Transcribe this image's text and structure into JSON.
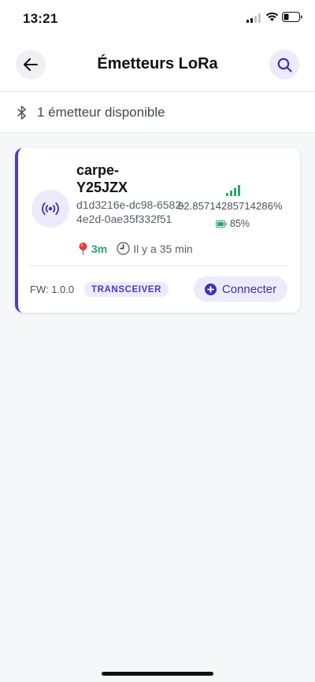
{
  "status_bar": {
    "time": "13:21",
    "signal_icon": "cellular-signal-icon",
    "wifi_icon": "wifi-icon",
    "battery_icon": "battery-icon"
  },
  "header": {
    "title": "Émetteurs LoRa",
    "back_icon": "arrow-left-icon",
    "search_icon": "search-icon"
  },
  "subheader": {
    "icon": "bluetooth-icon",
    "count_text": "1 émetteur disponible"
  },
  "devices": [
    {
      "name": "carpe-Y25JZX",
      "uuid": "d1d3216e-dc98-6582-4e2d-0ae35f332f51",
      "distance": "3m",
      "last_seen": "Il y a 35 min",
      "signal": "82.85714285714286%",
      "signal_level": 4,
      "battery": "85%",
      "battery_level": 0.85,
      "firmware": "FW: 1.0.0",
      "type_badge": "TRANSCEIVER",
      "connect_label": "Connecter",
      "icons": {
        "device": "radio-broadcast-icon",
        "location": "location-pin-icon",
        "clock": "clock-icon",
        "signal": "signal-bars-icon",
        "battery": "battery-icon",
        "connect": "plus-circle-icon"
      }
    }
  ],
  "colors": {
    "accent": "#4b3bd1",
    "accent_light": "#ecebfb",
    "success": "#2ea36a",
    "background": "#f6f7f9"
  }
}
